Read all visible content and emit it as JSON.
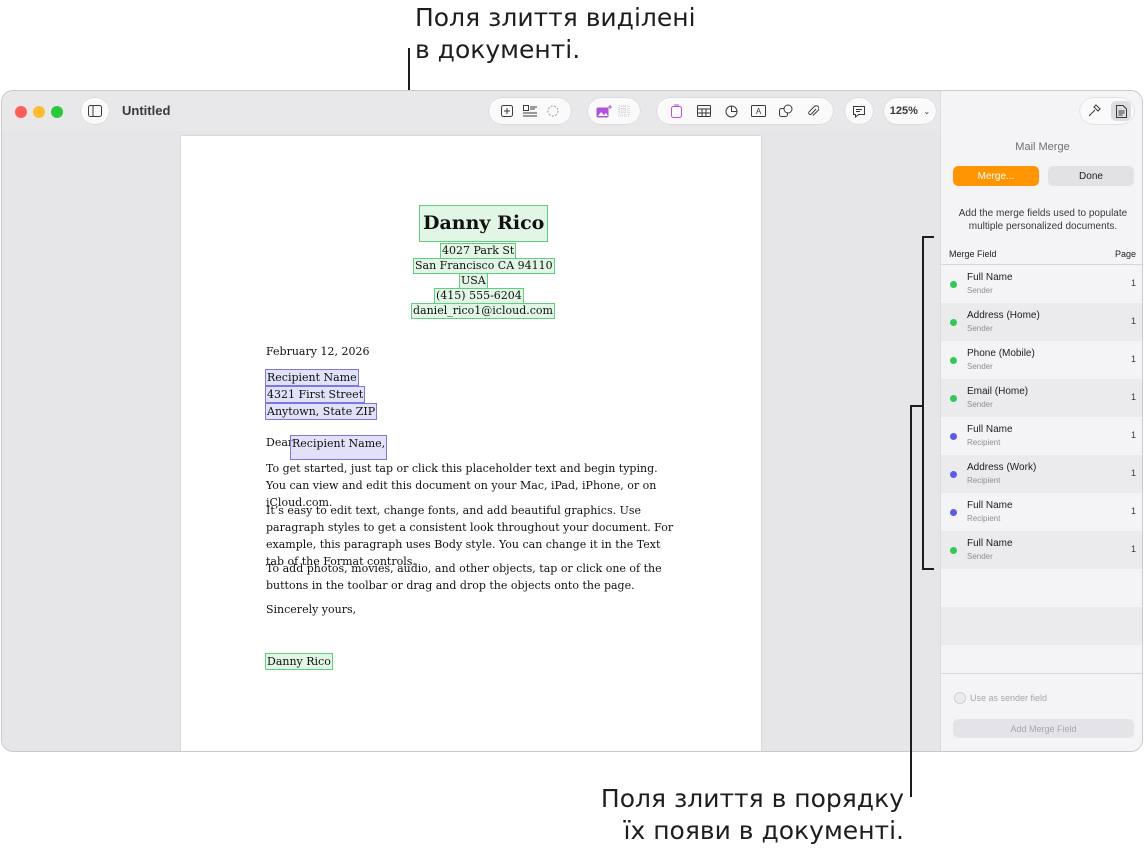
{
  "callouts": {
    "top_line1": "Поля злиття виділені",
    "top_line2": "в документі.",
    "bottom_line1": "Поля злиття в порядку",
    "bottom_line2": "їх появи в документі."
  },
  "window": {
    "title": "Untitled",
    "zoom": "125%"
  },
  "toolbar": {
    "icons": [
      "sidebar-icon",
      "insert-icon",
      "list-icon",
      "shape-magic-icon",
      "media-icon",
      "grid-icon",
      "page-icon",
      "table-icon",
      "chart-icon",
      "text-icon",
      "shape-icon",
      "attach-icon",
      "comment-icon",
      "share-icon",
      "format-icon",
      "document-icon"
    ]
  },
  "document": {
    "sender_name": "Danny Rico",
    "sender_street": "4027 Park St",
    "sender_city": "San Francisco CA 94110",
    "sender_country": "USA",
    "sender_phone": "(415) 555-6204",
    "sender_email": "daniel_rico1@icloud.com",
    "date": "February 12, 2026",
    "recipient_name": "Recipient Name",
    "recipient_street": "4321 First Street",
    "recipient_city": "Anytown, State ZIP",
    "greeting_prefix": "Dear",
    "greeting_name": "Recipient Name,",
    "para1": "To get started, just tap or click this placeholder text and begin typing. You can view and edit this document on your Mac, iPad, iPhone, or on iCloud.com.",
    "para2": "It’s easy to edit text, change fonts, and add beautiful graphics. Use paragraph styles to get a consistent look throughout your document. For example, this paragraph uses Body style. You can change it in the Text tab of the Format controls.",
    "para3": "To add photos, movies, audio, and other objects, tap or click one of the buttons in the toolbar or drag and drop the objects onto the page.",
    "closing": "Sincerely yours,",
    "signature": "Danny Rico"
  },
  "sidebar": {
    "title": "Mail Merge",
    "merge_button": "Merge...",
    "done_button": "Done",
    "description": "Add the merge fields used to populate multiple personalized documents.",
    "col_field": "Merge Field",
    "col_page": "Page",
    "fields": [
      {
        "name": "Full Name",
        "role": "Sender",
        "page": "1",
        "color": "#34c759"
      },
      {
        "name": "Address (Home)",
        "role": "Sender",
        "page": "1",
        "color": "#34c759"
      },
      {
        "name": "Phone (Mobile)",
        "role": "Sender",
        "page": "1",
        "color": "#34c759"
      },
      {
        "name": "Email (Home)",
        "role": "Sender",
        "page": "1",
        "color": "#34c759"
      },
      {
        "name": "Full Name",
        "role": "Recipient",
        "page": "1",
        "color": "#5e5ce6"
      },
      {
        "name": "Address (Work)",
        "role": "Recipient",
        "page": "1",
        "color": "#5e5ce6"
      },
      {
        "name": "Full Name",
        "role": "Recipient",
        "page": "1",
        "color": "#5e5ce6"
      },
      {
        "name": "Full Name",
        "role": "Sender",
        "page": "1",
        "color": "#34c759"
      }
    ],
    "sender_checkbox_label": "Use as sender field",
    "add_field_button": "Add Merge Field"
  }
}
